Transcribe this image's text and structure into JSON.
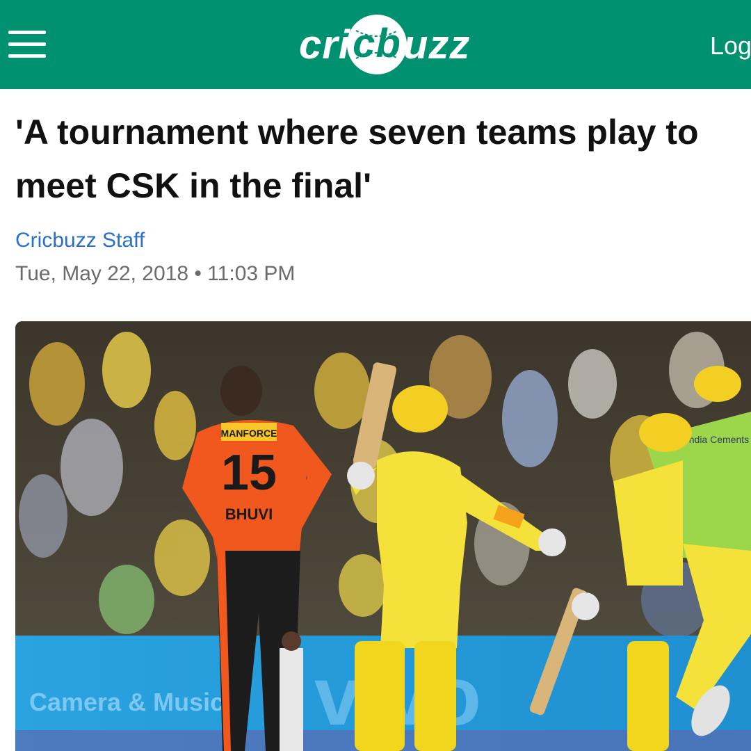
{
  "header": {
    "menu_icon": "hamburger-menu-icon",
    "logo": {
      "part1": "cri",
      "ball": "cb",
      "part2": "uzz"
    },
    "login_label": "Log",
    "background_color": "#009270"
  },
  "article": {
    "headline": "'A tournament where seven teams play to meet CSK in the final'",
    "author": "Cricbuzz Staff",
    "datetime": "Tue, May 22, 2018 • 11:03 PM",
    "author_color": "#2a6fc9"
  },
  "photo": {
    "jersey_sponsor": "MANFORCE",
    "jersey_number": "15",
    "jersey_name": "BHUVI",
    "bib_text": "India Cements",
    "board_text_left": "Camera & Music",
    "board_text_center": "vivo"
  }
}
